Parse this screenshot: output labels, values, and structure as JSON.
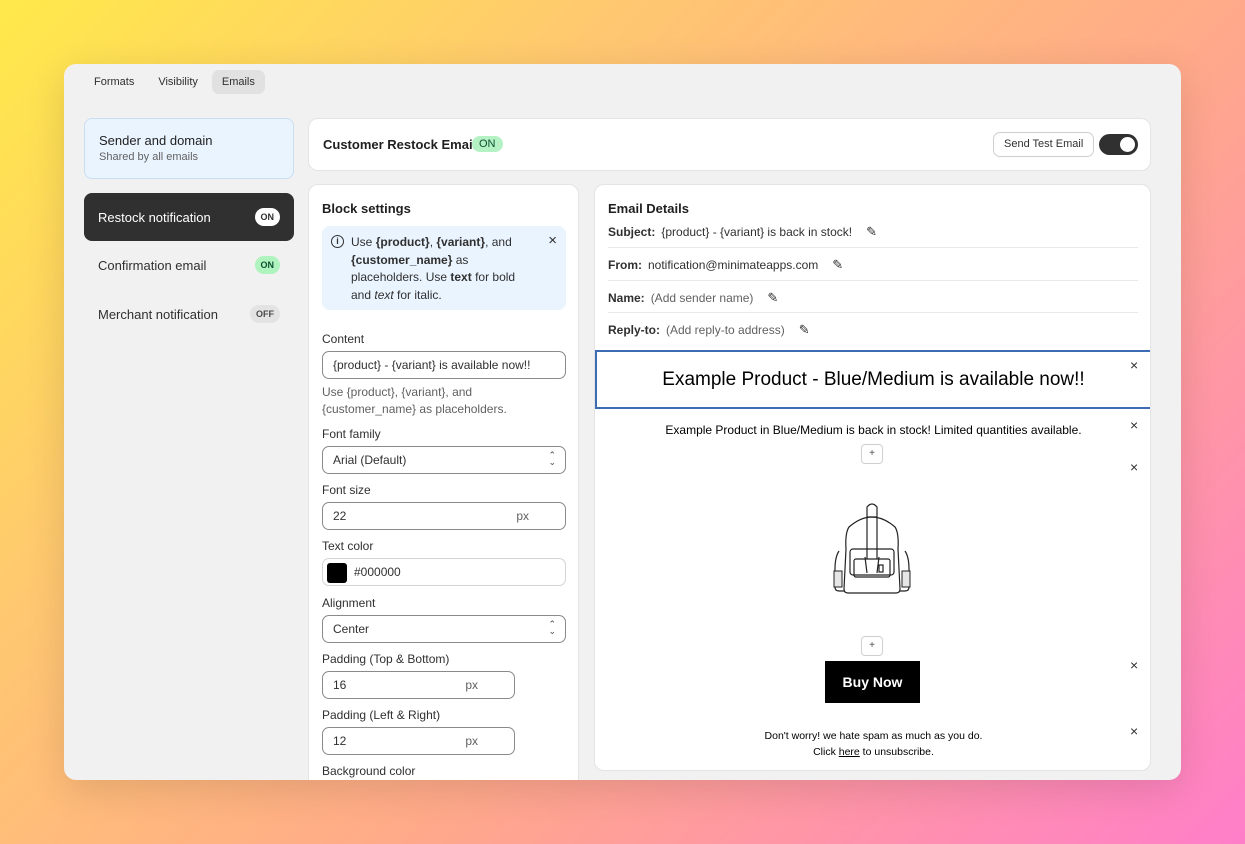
{
  "tabs": [
    "Formats",
    "Visibility",
    "Emails"
  ],
  "active_tab": "Emails",
  "sidebar": {
    "sender": {
      "title": "Sender and domain",
      "subtitle": "Shared by all emails"
    },
    "items": [
      {
        "label": "Restock notification",
        "status": "ON"
      },
      {
        "label": "Confirmation email",
        "status": "ON"
      },
      {
        "label": "Merchant notification",
        "status": "OFF"
      }
    ]
  },
  "header": {
    "title": "Customer Restock Email",
    "badge": "ON",
    "test_button": "Send Test Email"
  },
  "block_settings": {
    "title": "Block settings",
    "info": {
      "t1": "Use ",
      "b1": "{product}",
      "t2": ", ",
      "b2": "{variant}",
      "t3": ", and ",
      "b3": "{customer_name}",
      "t4": " as placeholders. Use ",
      "b4": "text",
      "t5": " for bold and ",
      "i1": "text",
      "t6": " for italic."
    },
    "content_label": "Content",
    "content_value": "{product} - {variant} is available now!!",
    "content_help": "Use {product}, {variant}, and {customer_name} as placeholders.",
    "font_family_label": "Font family",
    "font_family_value": "Arial (Default)",
    "font_size_label": "Font size",
    "font_size_value": "22",
    "px": "px",
    "text_color_label": "Text color",
    "text_color_value": "#000000",
    "alignment_label": "Alignment",
    "alignment_value": "Center",
    "padding_tb_label": "Padding (Top & Bottom)",
    "padding_tb_value": "16",
    "padding_lr_label": "Padding (Left & Right)",
    "padding_lr_value": "12",
    "bg_color_label": "Background color"
  },
  "email_details": {
    "title": "Email Details",
    "subject_label": "Subject:",
    "subject_value": "{product} - {variant} is back in stock!",
    "from_label": "From:",
    "from_value": "notification@minimateapps.com",
    "name_label": "Name:",
    "name_value": "(Add sender name)",
    "reply_label": "Reply-to:",
    "reply_value": "(Add reply-to address)"
  },
  "preview": {
    "heading": "Example Product - Blue/Medium is available now!!",
    "body": "Example Product in Blue/Medium is back in stock! Limited quantities available.",
    "button": "Buy Now",
    "footer_line1": "Don't worry! we hate spam as much as you do.",
    "footer_click": "Click ",
    "footer_link": "here",
    "footer_rest": " to unsubscribe."
  },
  "icons": {
    "close": "×",
    "plus": "+",
    "pencil": "✎",
    "info": "i",
    "select": "⌃⌄"
  }
}
